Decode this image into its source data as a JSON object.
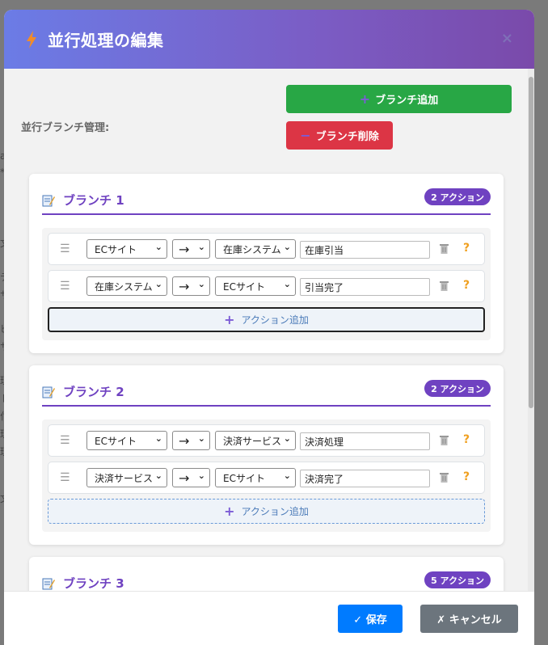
{
  "modal": {
    "title": "並行処理の編集",
    "close_label": "×"
  },
  "management": {
    "label": "並行ブランチ管理:",
    "add_branch_label": "ブランチ追加",
    "delete_branch_label": "ブランチ削除"
  },
  "branches": [
    {
      "title": "ブランチ 1",
      "badge": "2 アクション",
      "actions": [
        {
          "from": "ECサイト",
          "arrow": "→",
          "to": "在庫システム",
          "message": "在庫引当"
        },
        {
          "from": "在庫システム",
          "arrow": "→",
          "to": "ECサイト",
          "message": "引当完了"
        }
      ],
      "add_action_label": "アクション追加"
    },
    {
      "title": "ブランチ 2",
      "badge": "2 アクション",
      "actions": [
        {
          "from": "ECサイト",
          "arrow": "→",
          "to": "決済サービス",
          "message": "決済処理"
        },
        {
          "from": "決済サービス",
          "arrow": "→",
          "to": "ECサイト",
          "message": "決済完了"
        }
      ],
      "add_action_label": "アクション追加"
    },
    {
      "title": "ブランチ 3",
      "badge": "5 アクション"
    }
  ],
  "footer": {
    "save_label": "✓ 保存",
    "cancel_label": "✗ キャンセル"
  },
  "colors": {
    "accent": "#6f42c1",
    "add": "#28a745",
    "delete": "#dc3545",
    "save": "#007bff",
    "cancel": "#6c757d"
  }
}
